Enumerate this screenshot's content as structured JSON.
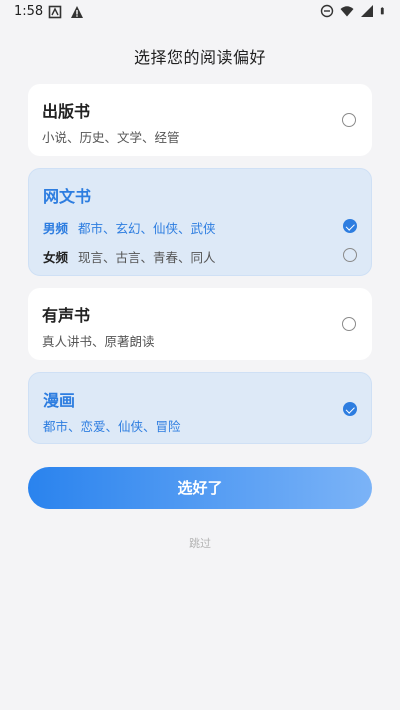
{
  "status": {
    "time": "1:58"
  },
  "title": "选择您的阅读偏好",
  "cards": [
    {
      "title": "出版书",
      "subtitle": "小说、历史、文学、经管",
      "checked": false
    },
    {
      "title": "网文书",
      "rows": [
        {
          "tag": "男频",
          "items": "都市、玄幻、仙侠、武侠",
          "checked": true
        },
        {
          "tag": "女频",
          "items": "现言、古言、青春、同人",
          "checked": false
        }
      ]
    },
    {
      "title": "有声书",
      "subtitle": "真人讲书、原著朗读",
      "checked": false
    },
    {
      "title": "漫画",
      "subtitle": "都市、恋爱、仙侠、冒险",
      "checked": true
    }
  ],
  "primary_button": "选好了",
  "skip": "跳过",
  "colors": {
    "accent": "#2d7de0",
    "selected_bg": "#dde9f7"
  }
}
